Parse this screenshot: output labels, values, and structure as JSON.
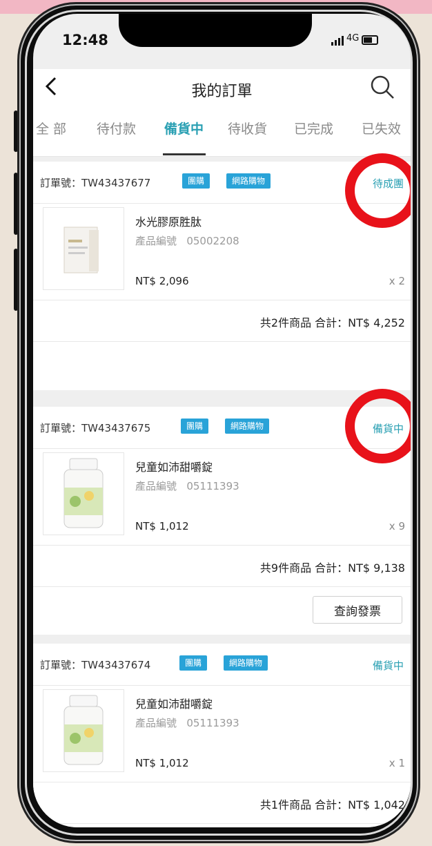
{
  "status_bar": {
    "time": "12:48",
    "network": "4G"
  },
  "nav": {
    "title": "我的訂單"
  },
  "tabs": [
    {
      "label": "全 部"
    },
    {
      "label": "待付款"
    },
    {
      "label": "備貨中",
      "active": true
    },
    {
      "label": "待收貨"
    },
    {
      "label": "已完成"
    },
    {
      "label": "已失效"
    }
  ],
  "orders": [
    {
      "order_no": "訂單號：TW43437677",
      "tags": [
        "團購",
        "網路購物"
      ],
      "status": "待成團",
      "product": {
        "name": "水光膠原胜肽",
        "code_label": "產品編號",
        "code": "05002208",
        "price": "NT$ 2,096",
        "qty": "x 2"
      },
      "summary": "共2件商品 合計：NT$ 4,252"
    },
    {
      "order_no": "訂單號：TW43437675",
      "tags": [
        "團購",
        "網路購物"
      ],
      "status": "備貨中",
      "product": {
        "name": "兒童如沛甜嚼錠",
        "code_label": "產品編號",
        "code": "05111393",
        "price": "NT$ 1,012",
        "qty": "x 9"
      },
      "summary": "共9件商品 合計：NT$ 9,138",
      "action": "查詢發票"
    },
    {
      "order_no": "訂單號：TW43437674",
      "tags": [
        "團購",
        "網路購物"
      ],
      "status": "備貨中",
      "product": {
        "name": "兒童如沛甜嚼錠",
        "code_label": "產品編號",
        "code": "05111393",
        "price": "NT$ 1,012",
        "qty": "x 1"
      },
      "summary": "共1件商品 合計：NT$ 1,042"
    }
  ],
  "colors": {
    "accent": "#2aa0b3",
    "tag": "#29a3d8",
    "highlight_ring": "#e8121a"
  },
  "icons": [
    "back-chevron-icon",
    "search-icon",
    "signal-icon",
    "battery-icon"
  ]
}
